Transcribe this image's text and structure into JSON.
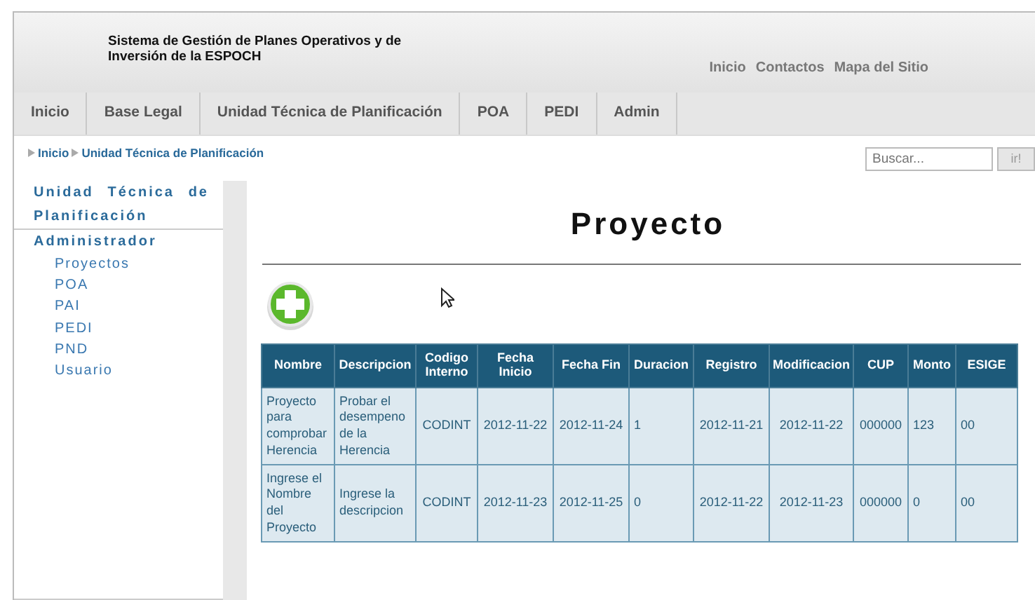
{
  "header": {
    "title": "Sistema de Gestión de Planes Operativos y de Inversión de la ESPOCH",
    "links": [
      "Inicio",
      "Contactos",
      "Mapa del Sitio"
    ]
  },
  "nav": [
    "Inicio",
    "Base Legal",
    "Unidad Técnica de Planificación",
    "POA",
    "PEDI",
    "Admin"
  ],
  "breadcrumb": [
    "Inicio",
    "Unidad Técnica de Planificación"
  ],
  "search": {
    "placeholder": "Buscar...",
    "button": "ir!"
  },
  "sidebar": [
    {
      "label": "Unidad Técnica de Planificación"
    },
    {
      "label": "Administrador",
      "children": [
        {
          "label": "Proyectos"
        },
        {
          "label": "POA"
        },
        {
          "label": "PAI"
        },
        {
          "label": "PEDI"
        },
        {
          "label": "PND"
        },
        {
          "label": "Usuario"
        }
      ]
    }
  ],
  "page_title": "Proyecto",
  "table": {
    "columns": [
      "Nombre",
      "Descripcion",
      "Codigo Interno",
      "Fecha Inicio",
      "Fecha Fin",
      "Duracion",
      "Registro",
      "Modificacion",
      "CUP",
      "Monto",
      "ESIGE"
    ],
    "rows": [
      [
        "Proyecto para comprobar Herencia",
        "Probar el desempeno de la Herencia",
        "CODINT",
        "2012-11-22",
        "2012-11-24",
        "1",
        "2012-11-21",
        "2012-11-22",
        "000000",
        "123",
        "00"
      ],
      [
        "Ingrese el Nombre del Proyecto",
        "Ingrese la descripcion",
        "CODINT",
        "2012-11-23",
        "2012-11-25",
        "0",
        "2012-11-22",
        "2012-11-23",
        "000000",
        "0",
        "00"
      ]
    ]
  }
}
